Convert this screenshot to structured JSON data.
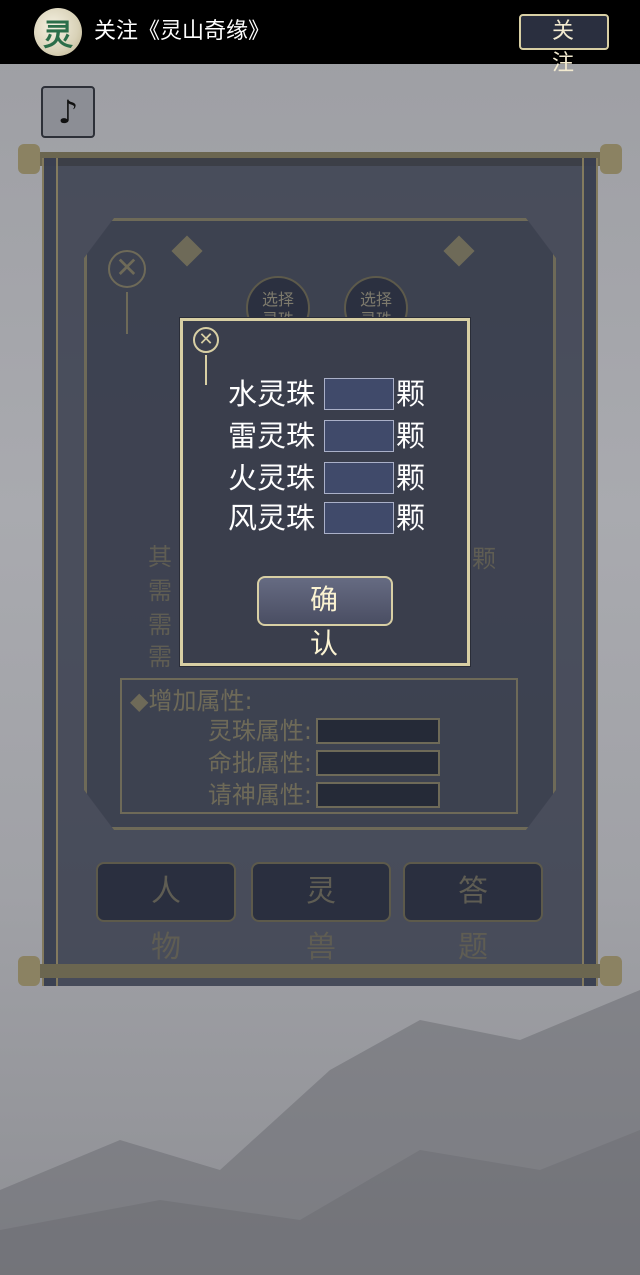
{
  "topbar": {
    "logo_char": "灵",
    "title": "关注《灵山奇缘》",
    "follow_label": "关 注"
  },
  "music": {
    "icon": "music-note-icon",
    "glyph": "♪"
  },
  "panel": {
    "close_glyph": "✕",
    "select_buttons": [
      {
        "label": "选择\n灵珠"
      },
      {
        "label": "选择\n灵珠"
      }
    ],
    "bg_lines": [
      "其",
      "需",
      "需",
      "需"
    ],
    "bg_unit": "颗",
    "attributes": {
      "title": "◆增加属性:",
      "rows": [
        {
          "label": "灵珠属性:"
        },
        {
          "label": "命批属性:"
        },
        {
          "label": "请神属性:"
        }
      ]
    },
    "tabs": [
      {
        "label": "人 物"
      },
      {
        "label": "灵 兽"
      },
      {
        "label": "答 题"
      }
    ]
  },
  "modal": {
    "close_glyph": "✕",
    "rows": [
      {
        "label": "水灵珠",
        "unit": "颗",
        "value": ""
      },
      {
        "label": "雷灵珠",
        "unit": "颗",
        "value": ""
      },
      {
        "label": "火灵珠",
        "unit": "颗",
        "value": ""
      },
      {
        "label": "风灵珠",
        "unit": "颗",
        "value": ""
      }
    ],
    "confirm_label": "确 认"
  },
  "colors": {
    "accent": "#d8cfa4",
    "dialog_bg": "#3a3e4c",
    "topbar": "#000000"
  }
}
